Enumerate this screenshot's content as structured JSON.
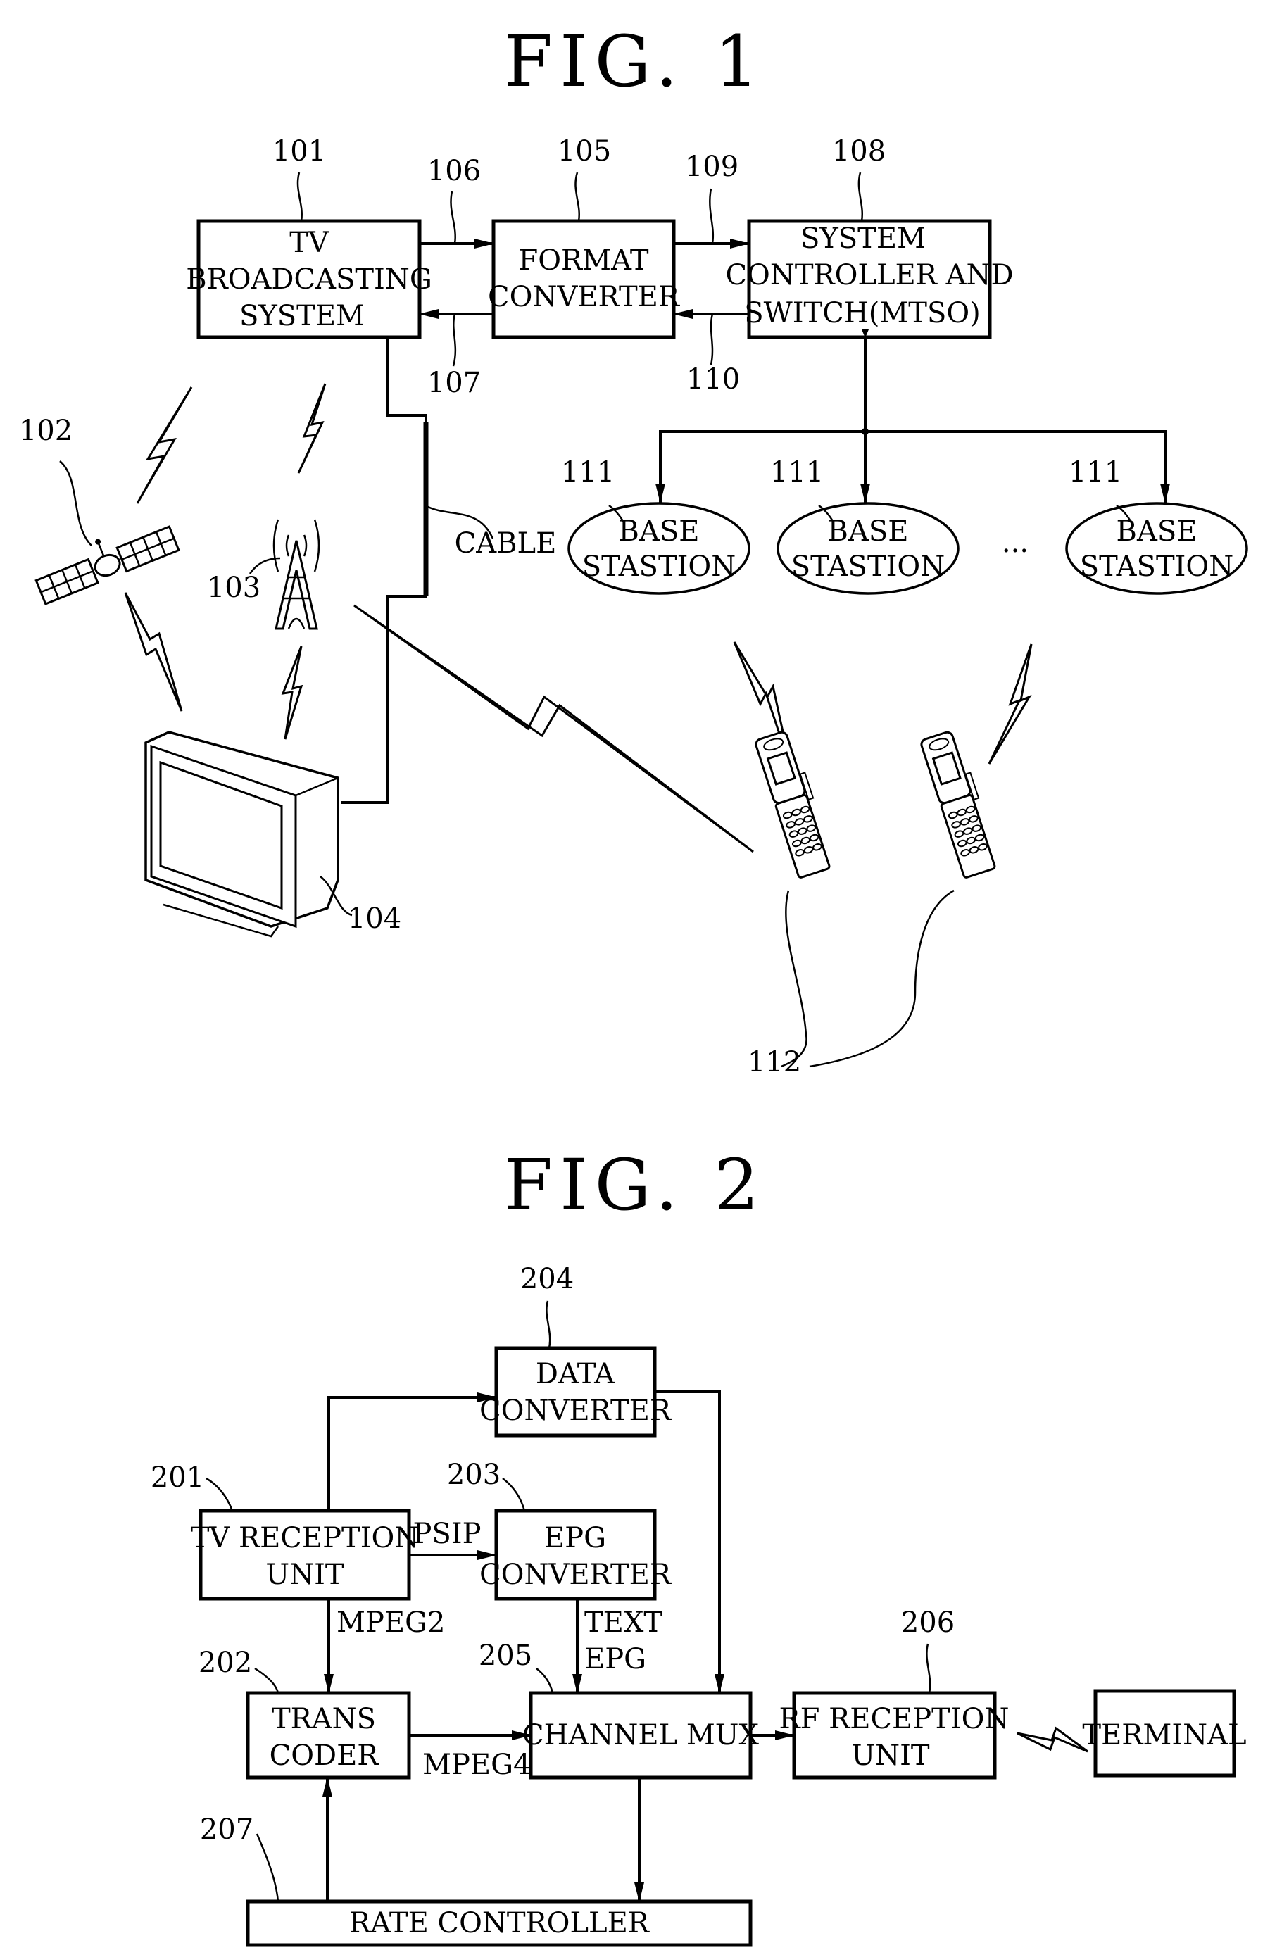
{
  "fig1": {
    "title": "FIG. 1",
    "blocks": {
      "tv_broadcasting": {
        "ref": "101",
        "lines": [
          "TV",
          "BROADCASTING",
          "SYSTEM"
        ]
      },
      "format_converter": {
        "ref": "105",
        "lines": [
          "FORMAT",
          "CONVERTER"
        ]
      },
      "system_controller": {
        "ref": "108",
        "lines": [
          "SYSTEM",
          "CONTROLLER AND",
          "SWITCH(MTSO)"
        ]
      }
    },
    "signal_refs": {
      "s106": "106",
      "s107": "107",
      "s109": "109",
      "s110": "110"
    },
    "base_stations": [
      {
        "ref": "111",
        "lines": [
          "BASE",
          "STASTION"
        ]
      },
      {
        "ref": "111",
        "lines": [
          "BASE",
          "STASTION"
        ]
      },
      {
        "ref": "111",
        "lines": [
          "BASE",
          "STASTION"
        ]
      }
    ],
    "ellipsis": "...",
    "satellite_ref": "102",
    "tower_ref": "103",
    "tv_ref": "104",
    "cable_label": "CABLE",
    "terminals_ref": "112"
  },
  "fig2": {
    "title": "FIG. 2",
    "blocks": {
      "data_converter": {
        "ref": "204",
        "lines": [
          "DATA",
          "CONVERTER"
        ]
      },
      "tv_reception": {
        "ref": "201",
        "lines": [
          "TV RECEPTION",
          "UNIT"
        ]
      },
      "epg_converter": {
        "ref": "203",
        "lines": [
          "EPG",
          "CONVERTER"
        ]
      },
      "trans_coder": {
        "ref": "202",
        "lines": [
          "TRANS",
          "CODER"
        ]
      },
      "channel_mux": {
        "ref": "205",
        "lines": [
          "CHANNEL MUX"
        ]
      },
      "rf_reception": {
        "ref": "206",
        "lines": [
          "RF RECEPTION",
          "UNIT"
        ]
      },
      "terminal": {
        "lines": [
          "TERMINAL"
        ]
      },
      "rate_controller": {
        "ref": "207",
        "lines": [
          "RATE CONTROLLER"
        ]
      }
    },
    "signals": {
      "psip": "PSIP",
      "mpeg2": "MPEG2",
      "mpeg4": "MPEG4",
      "text": "TEXT",
      "epg": "EPG"
    }
  }
}
